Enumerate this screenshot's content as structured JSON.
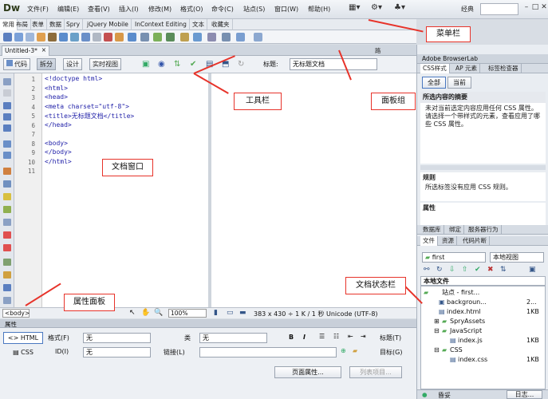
{
  "app": {
    "logo": "Dw"
  },
  "menu": {
    "items": [
      "文件(F)",
      "编辑(E)",
      "查看(V)",
      "插入(I)",
      "修改(M)",
      "格式(O)",
      "命令(C)",
      "站点(S)",
      "窗口(W)",
      "帮助(H)"
    ],
    "layout_label": "经典"
  },
  "insert_tabs": [
    "常用",
    "布局",
    "表单",
    "数据",
    "Spry",
    "jQuery Mobile",
    "InContext Editing",
    "文本",
    "收藏夹"
  ],
  "document": {
    "tab": "Untitled-3*",
    "path": "路"
  },
  "doc_toolbar": {
    "code": "代码",
    "split": "拆分",
    "design": "设计",
    "live": "实时视图",
    "title_label": "标题:",
    "title_value": "无标题文档"
  },
  "code_lines": [
    "<!doctype html>",
    "<html>",
    "<head>",
    "<meta charset=\"utf-8\">",
    "<title>无标题文档</title>",
    "</head>",
    "",
    "<body>",
    "</body>",
    "</html>",
    ""
  ],
  "line_numbers": [
    "1",
    "2",
    "3",
    "4",
    "5",
    "6",
    "7",
    "8",
    "9",
    "10",
    "11"
  ],
  "status_bar": {
    "tag": "<body>",
    "zoom": "100%",
    "info": "383 x 430 ÷ 1 K / 1 秒 Unicode (UTF-8)"
  },
  "properties": {
    "title": "属性",
    "html_btn": "HTML",
    "css_btn": "CSS",
    "format_label": "格式(F)",
    "format_value": "无",
    "id_label": "ID(I)",
    "id_value": "无",
    "class_label": "类",
    "class_value": "无",
    "bold": "B",
    "italic": "I",
    "title_label": "标题(T)",
    "link_label": "链接(L)",
    "target_label": "目标(G)",
    "page_props": "页面属性...",
    "list_items": "列表项目..."
  },
  "right_panel": {
    "browserlab": "Adobe BrowserLab",
    "css_tabs": [
      "CSS样式",
      "AP 元素",
      "标签检查器"
    ],
    "css_modes": [
      "全部",
      "当前"
    ],
    "summary_title": "所选内容的摘要",
    "summary_text": "未对当前选定内容应用任何 CSS 属性。请选择一个带样式的元素，查看应用了哪些 CSS 属性。",
    "rules_title": "规则",
    "rules_text": "所选标签没有应用 CSS 规则。",
    "props_title": "属性",
    "db_tabs": [
      "数据库",
      "绑定",
      "服务器行为"
    ],
    "file_tabs": [
      "文件",
      "资源",
      "代码片断"
    ],
    "site_select": "first",
    "view_select": "本地视图",
    "local_files_header": "本地文件",
    "files": [
      {
        "name": "站点 - first...",
        "size": ""
      },
      {
        "name": "backgroun...",
        "size": "2..."
      },
      {
        "name": "index.html",
        "size": "1KB"
      },
      {
        "name": "SpryAssets",
        "size": ""
      },
      {
        "name": "JavaScript",
        "size": ""
      },
      {
        "name": "index.js",
        "size": "1KB"
      },
      {
        "name": "CSS",
        "size": ""
      },
      {
        "name": "index.css",
        "size": "1KB"
      }
    ],
    "footer_left": "昏妥",
    "footer_right": "日志..."
  },
  "annotations": {
    "menubar": "菜单栏",
    "toolbar": "工具栏",
    "panelgroup": "面板组",
    "docwindow": "文档窗口",
    "docstatus": "文档状态栏",
    "propertypanel": "属性面板"
  }
}
